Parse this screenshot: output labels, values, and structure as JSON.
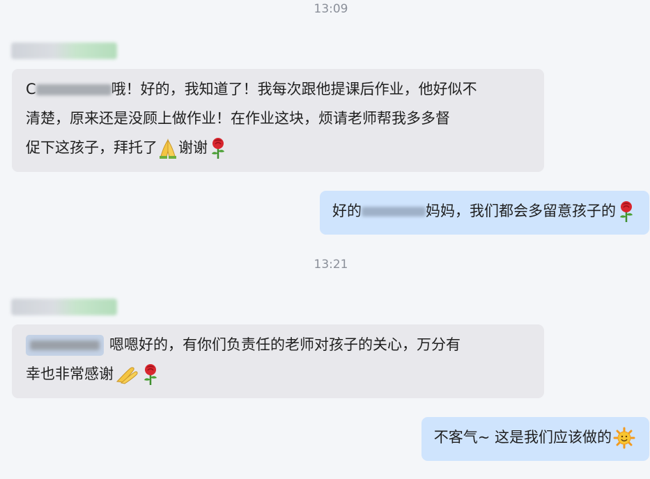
{
  "messages": [
    {
      "time": "13:09"
    },
    {
      "incoming": {
        "prefix": "C",
        "line1": "哦！好的，我知道了！我每次跟他提课后作业，他好似不",
        "line2": "清楚，原来还是没顾上做作业！在作业这块，烦请老师帮我多多督",
        "line3_a": "促下这孩子，拜托了",
        "line3_b": "谢谢",
        "emoji_1": "folded-hands-icon",
        "emoji_2": "rose-icon"
      }
    },
    {
      "outgoing": {
        "text_a": "好的",
        "text_b": "妈妈，我们都会多留意孩子的",
        "emoji": "rose-icon"
      }
    },
    {
      "time": "13:21"
    },
    {
      "incoming": {
        "line1": "嗯嗯好的，有你们负责任的老师对孩子的关心，万分有",
        "line2": "幸也非常感谢",
        "emoji_1": "folded-hands-icon",
        "emoji_2": "rose-icon"
      }
    },
    {
      "outgoing": {
        "text": "不客气~ 这是我们应该做的",
        "emoji": "sun-face-icon"
      }
    }
  ],
  "colors": {
    "background": "#f4f6f9",
    "incoming_bubble": "#e8e8ec",
    "outgoing_bubble": "#cfe4fd",
    "timestamp": "#8a8f99"
  }
}
